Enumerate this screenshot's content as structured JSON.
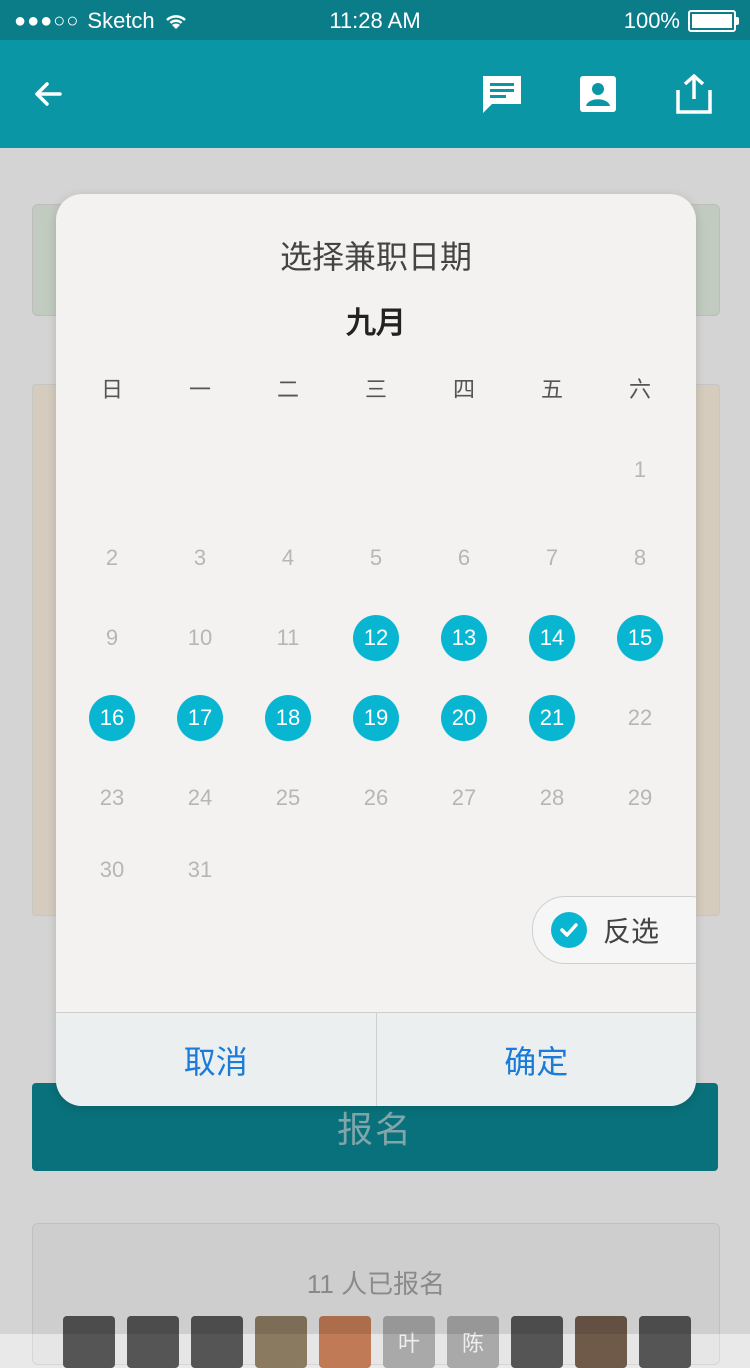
{
  "status_bar": {
    "carrier": "Sketch",
    "signal": "●●●○○",
    "time": "11:28 AM",
    "battery": "100%"
  },
  "navbar": {
    "icons": [
      "back-arrow-icon",
      "chat-icon",
      "contact-icon",
      "share-icon"
    ]
  },
  "background": {
    "signup_label": "报名",
    "enrolled_text": "11 人已报名",
    "avatar_labels": [
      "叶",
      "陈"
    ]
  },
  "dialog": {
    "title": "选择兼职日期",
    "month": "九月",
    "weekdays": [
      "日",
      "一",
      "二",
      "三",
      "四",
      "五",
      "六"
    ],
    "weeks": [
      [
        "",
        "",
        "",
        "",
        "",
        "",
        "1"
      ],
      [
        "2",
        "3",
        "4",
        "5",
        "6",
        "7",
        "8"
      ],
      [
        "9",
        "10",
        "11",
        "12",
        "13",
        "14",
        "15"
      ],
      [
        "16",
        "17",
        "18",
        "19",
        "20",
        "21",
        "22"
      ],
      [
        "23",
        "24",
        "25",
        "26",
        "27",
        "28",
        "29"
      ],
      [
        "30",
        "31",
        "",
        "",
        "",
        "",
        ""
      ]
    ],
    "selected_days": [
      "12",
      "13",
      "14",
      "15",
      "16",
      "17",
      "18",
      "19",
      "20",
      "21"
    ],
    "invert_label": "反选",
    "cancel_label": "取消",
    "confirm_label": "确定"
  },
  "colors": {
    "header": "#0b96a5",
    "selected": "#09b6d2",
    "action": "#1a7cd8"
  }
}
